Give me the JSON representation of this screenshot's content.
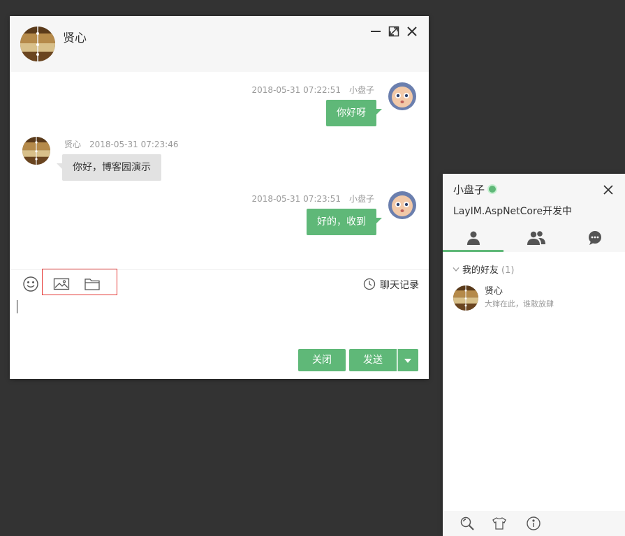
{
  "chat_window": {
    "title": "贤心",
    "controls": {
      "minimize": "minimize-icon",
      "maximize": "maximize-icon",
      "close": "close-icon"
    },
    "messages": [
      {
        "side": "mine",
        "time": "2018-05-31 07:22:51",
        "sender": "小盘子",
        "text": "你好呀"
      },
      {
        "side": "other",
        "sender": "贤心",
        "time": "2018-05-31 07:23:46",
        "text": "你好，博客园演示"
      },
      {
        "side": "mine",
        "time": "2018-05-31 07:23:51",
        "sender": "小盘子",
        "text": "好的，收到"
      }
    ],
    "toolbar": {
      "icons": [
        "face-icon",
        "image-icon",
        "folder-icon"
      ],
      "history_label": "聊天记录"
    },
    "input": {
      "value": ""
    },
    "buttons": {
      "close_label": "关闭",
      "send_label": "发送"
    }
  },
  "main_panel": {
    "username": "小盘子",
    "status_color": "#5fb878",
    "sign": "LayIM.AspNetCore开发中",
    "tabs": [
      "friend-tab-icon",
      "group-tab-icon",
      "history-tab-icon"
    ],
    "group": {
      "name": "我的好友",
      "count": "(1)"
    },
    "friends": [
      {
        "name": "贤心",
        "sign": "大婶在此，谁敢放肆"
      }
    ],
    "footer_icons": [
      "search-icon",
      "skin-icon",
      "about-icon"
    ]
  },
  "colors": {
    "accent": "#5fb878",
    "background": "#333333",
    "header": "#f6f6f6",
    "bubble_other": "#e2e2e2"
  }
}
